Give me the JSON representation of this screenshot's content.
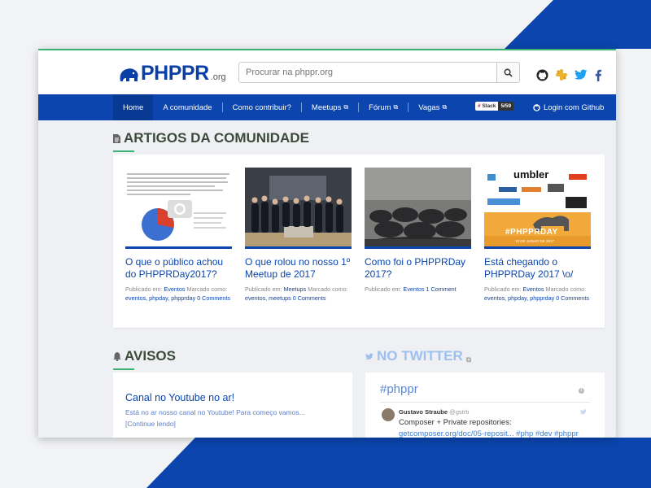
{
  "colors": {
    "brand_blue": "#0b45ad",
    "accent_green": "#3bb273",
    "bg": "#f2f3f5"
  },
  "logo": {
    "word": "PHPPR",
    "suffix": ".org"
  },
  "search": {
    "placeholder": "Procurar na phppr.org"
  },
  "social": [
    "github-icon",
    "slack-icon",
    "twitter-icon",
    "facebook-icon"
  ],
  "nav": {
    "items": [
      {
        "label": "Home",
        "active": true
      },
      {
        "label": "A comunidade"
      },
      {
        "label": "Como contribuir?"
      },
      {
        "label": "Meetups",
        "external": true
      },
      {
        "label": "Fórum",
        "external": true
      },
      {
        "label": "Vagas",
        "external": true
      }
    ],
    "slack_label": "Slack",
    "slack_count": "5/59",
    "login": "Login com Github"
  },
  "articles": {
    "title": "ARTIGOS DA COMUNIDADE",
    "cards": [
      {
        "title": "O que o público achou do PHPPRDay2017?",
        "published": "Publicado em:",
        "category": "Eventos",
        "tagged": "Marcado como:",
        "tags": "eventos, phpday, phpprday",
        "comments": "0 Comments"
      },
      {
        "title": "O que rolou no nosso 1º Meetup de 2017",
        "published": "Publicado em:",
        "category": "Meetups",
        "tagged": "Marcado como:",
        "tags": "eventos, meetups",
        "comments": "0 Comments"
      },
      {
        "title": "Como foi o PHPPRDay 2017?",
        "published": "Publicado em:",
        "category": "Eventos",
        "tagged": "",
        "tags": "",
        "comments": "1 Comment"
      },
      {
        "title": "Está chegando o PHPPRDay 2017 \\o/",
        "published": "Publicado em:",
        "category": "Eventos",
        "tagged": "Marcado como:",
        "tags": "eventos, phpday, phpprday",
        "comments": "0 Comments"
      }
    ],
    "thumb4_text": {
      "brand": "umbler",
      "hashtag": "#PHPPRDAY",
      "date": "10 DE JUNHO DE 2017"
    }
  },
  "avisos": {
    "title": "AVISOS",
    "post_title": "Canal no Youtube no ar!",
    "excerpt": "Está no ar nosso canal no Youtube! Para começo vamos...",
    "more": "[Continue lendo]"
  },
  "twitter": {
    "title": "NO TWITTER",
    "hashtag": "#phppr",
    "author": "Gustavo Straube",
    "handle": "@gstrb",
    "text": "Composer + Private repositories:",
    "link": "getcomposer.org/doc/05-reposit...",
    "tags": "#php #dev #phppr"
  }
}
